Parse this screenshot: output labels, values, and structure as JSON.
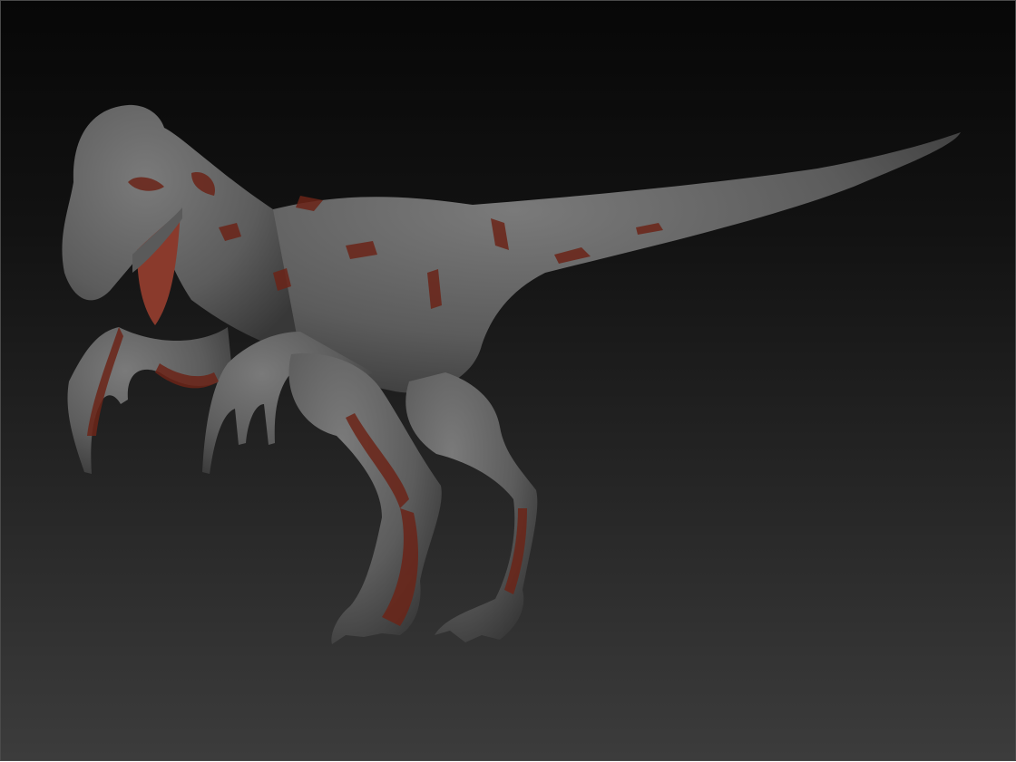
{
  "viewport": {
    "subject": "raptor-sculpt",
    "colors": {
      "background_top": "#070707",
      "background_bottom": "#3c3c3c",
      "skin": "#6a6a6a",
      "skin_shadow": "#3e3e3e",
      "mask_red": "#6b2418",
      "mouth": "#8a3a2c"
    }
  }
}
